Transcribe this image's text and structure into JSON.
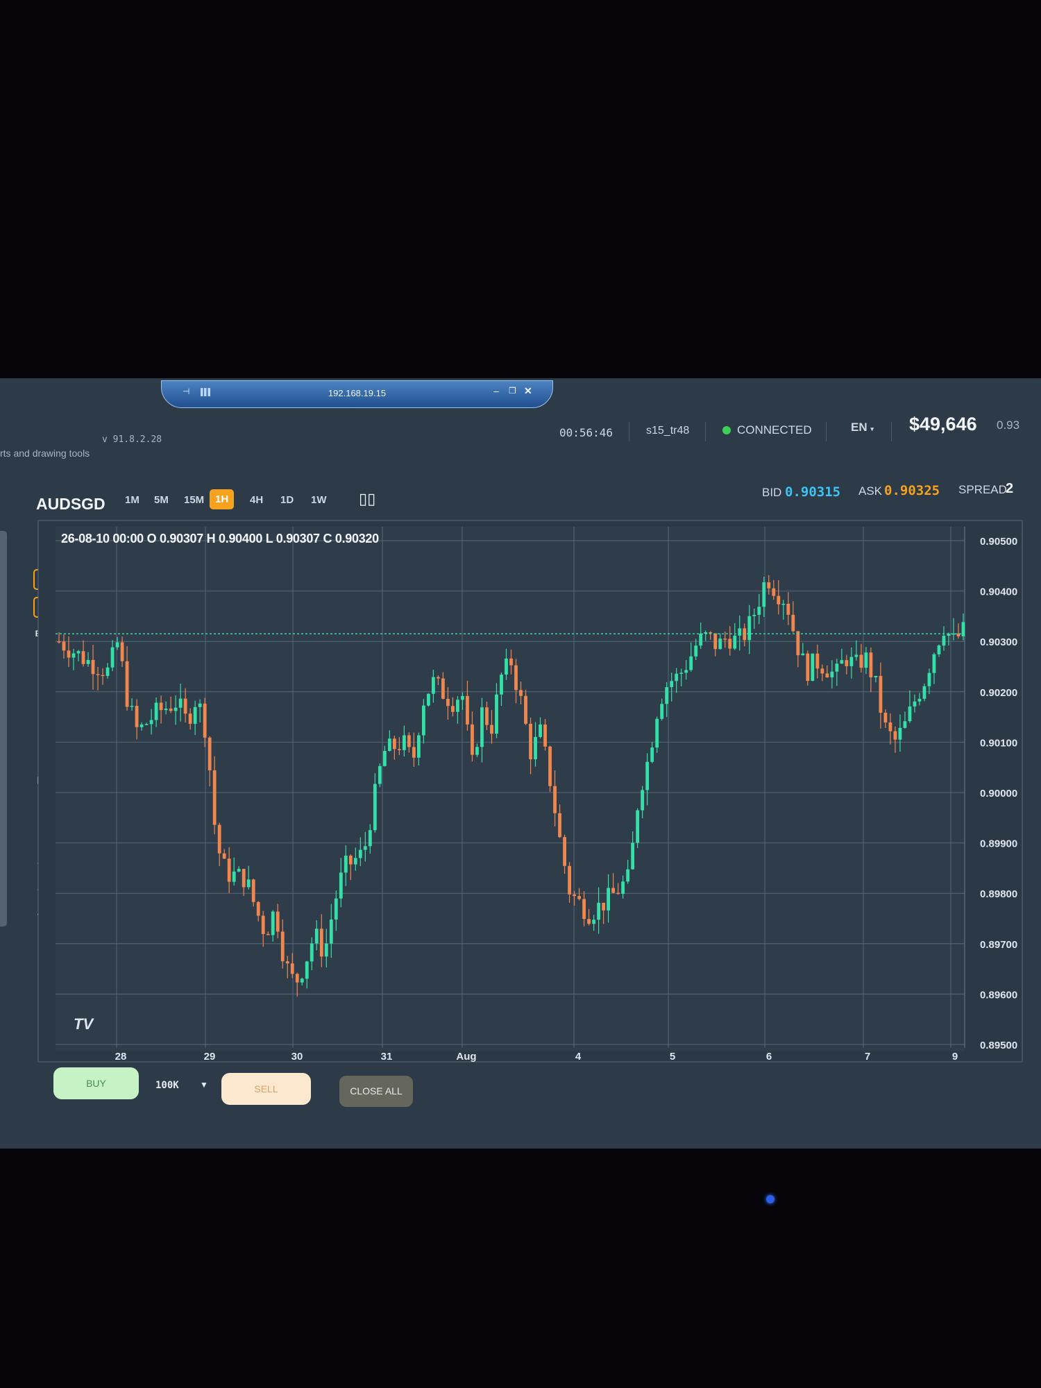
{
  "remote_bar": {
    "ip": "192.168.19.15"
  },
  "header": {
    "subtitle": "rts and drawing tools",
    "version": "v 91.8.2.28",
    "clock": "00:56:46",
    "user": "s15_tr48",
    "status": "CONNECTED",
    "status_color": "#3ecf5a",
    "language": "EN",
    "balance": "$49,646",
    "balance_extra": "0.93"
  },
  "toolbar": {
    "symbol": "AUDSGD",
    "timeframes": [
      "1M",
      "5M",
      "15M",
      "1H",
      "4H",
      "1D",
      "1W"
    ],
    "active_timeframe": "1H",
    "bid_label": "BID",
    "bid": "0.90315",
    "ask_label": "ASK",
    "ask": "0.90325",
    "spread_label": "SPREAD",
    "spread": "2"
  },
  "left_tools": [
    {
      "icon": "fullscreen-icon"
    },
    {
      "icon": "crosshair-icon",
      "selected": true
    },
    {
      "icon": "move-icon",
      "selected": true
    },
    {
      "icon": "bid-ask-icon",
      "label": "B/A"
    },
    {
      "icon": "measure-icon"
    },
    {
      "icon": "line-icon"
    },
    {
      "icon": "pencil-icon"
    },
    {
      "icon": "fib-icon"
    },
    {
      "icon": "rectangle-icon"
    },
    {
      "icon": "magnet-icon"
    },
    {
      "icon": "lock-icon"
    },
    {
      "icon": "undo-icon"
    },
    {
      "icon": "redo-icon"
    },
    {
      "icon": "trash-icon"
    }
  ],
  "ohlc_legend": "26-08-10 00:00 O 0.90307 H 0.90400 L 0.90307 C 0.90320",
  "chart_data": {
    "type": "candlestick",
    "symbol": "AUDSGD",
    "timeframe": "1H",
    "x_ticks": [
      "28",
      "29",
      "30",
      "31",
      "Aug",
      "4",
      "5",
      "6",
      "7",
      "9"
    ],
    "y_ticks": [
      "0.90500",
      "0.90400",
      "0.90300",
      "0.90200",
      "0.90100",
      "0.90000",
      "0.89900",
      "0.89800",
      "0.89700",
      "0.89600",
      "0.89500"
    ],
    "ylim": [
      0.895,
      0.905
    ],
    "grid": true,
    "up_color": "#35e0a8",
    "down_color": "#f2874e",
    "current_price_line": 0.90315,
    "anchors": [
      [
        0,
        0.903
      ],
      [
        3,
        0.9026
      ],
      [
        5,
        0.9024
      ],
      [
        6,
        0.903
      ],
      [
        7,
        0.9018
      ],
      [
        8,
        0.9012
      ],
      [
        10,
        0.9016
      ],
      [
        12,
        0.9018
      ],
      [
        13,
        0.9014
      ],
      [
        14,
        0.9019
      ],
      [
        15,
        0.9012
      ],
      [
        16,
        0.899
      ],
      [
        17,
        0.8984
      ],
      [
        19,
        0.8983
      ],
      [
        20,
        0.8977
      ],
      [
        21,
        0.8972
      ],
      [
        22,
        0.8977
      ],
      [
        23,
        0.8966
      ],
      [
        24,
        0.8962
      ],
      [
        25,
        0.8966
      ],
      [
        26,
        0.8972
      ],
      [
        27,
        0.8968
      ],
      [
        28,
        0.8978
      ],
      [
        29,
        0.8985
      ],
      [
        31,
        0.8988
      ],
      [
        32,
        0.8998
      ],
      [
        33,
        0.9008
      ],
      [
        35,
        0.901
      ],
      [
        36,
        0.9006
      ],
      [
        37,
        0.9018
      ],
      [
        38,
        0.9022
      ],
      [
        40,
        0.9018
      ],
      [
        41,
        0.902
      ],
      [
        42,
        0.9005
      ],
      [
        43,
        0.9016
      ],
      [
        44,
        0.9013
      ],
      [
        45,
        0.9023
      ],
      [
        46,
        0.9026
      ],
      [
        47,
        0.9018
      ],
      [
        48,
        0.9008
      ],
      [
        49,
        0.9012
      ],
      [
        50,
        0.9002
      ],
      [
        51,
        0.899
      ],
      [
        52,
        0.898
      ],
      [
        53,
        0.8978
      ],
      [
        54,
        0.8976
      ],
      [
        56,
        0.8979
      ],
      [
        57,
        0.8981
      ],
      [
        58,
        0.8983
      ],
      [
        59,
        0.9
      ],
      [
        60,
        0.9007
      ],
      [
        61,
        0.9018
      ],
      [
        62,
        0.9022
      ],
      [
        63,
        0.9023
      ],
      [
        64,
        0.9026
      ],
      [
        65,
        0.903
      ],
      [
        66,
        0.9031
      ],
      [
        67,
        0.9029
      ],
      [
        68,
        0.9031
      ],
      [
        69,
        0.903
      ],
      [
        70,
        0.9032
      ],
      [
        71,
        0.9037
      ],
      [
        72,
        0.9043
      ],
      [
        73,
        0.904
      ],
      [
        74,
        0.9038
      ],
      [
        75,
        0.903
      ],
      [
        76,
        0.9024
      ],
      [
        77,
        0.9026
      ],
      [
        78,
        0.9025
      ],
      [
        79,
        0.9023
      ],
      [
        80,
        0.9027
      ],
      [
        81,
        0.9025
      ],
      [
        82,
        0.9027
      ],
      [
        83,
        0.9022
      ],
      [
        84,
        0.9013
      ],
      [
        85,
        0.901
      ],
      [
        86,
        0.9013
      ],
      [
        87,
        0.9018
      ],
      [
        88,
        0.9022
      ],
      [
        89,
        0.9028
      ],
      [
        90,
        0.9033
      ],
      [
        91,
        0.903
      ],
      [
        92,
        0.9032
      ]
    ],
    "candle_count": 187
  },
  "watermark": "TV",
  "order_bar": {
    "buy_label": "BUY",
    "quantity": "100K",
    "sell_label": "SELL",
    "close_all_label": "CLOSE ALL"
  }
}
